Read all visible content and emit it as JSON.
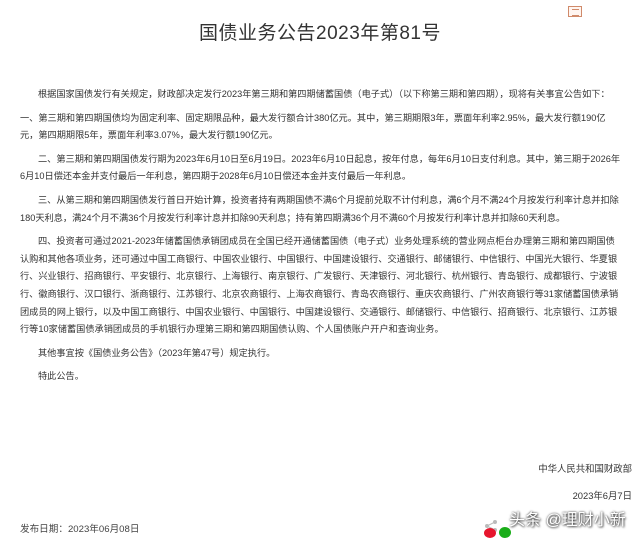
{
  "title": "国债业务公告2023年第81号",
  "paragraphs": [
    "根据国家国债发行有关规定，财政部决定发行2023年第三期和第四期储蓄国债（电子式）（以下称第三期和第四期），现将有关事宜公告如下：",
    "一、第三期和第四期国债均为固定利率、固定期限品种，最大发行额合计380亿元。其中，第三期期限3年，票面年利率2.95%，最大发行额190亿元，第四期期限5年，票面年利率3.07%，最大发行额190亿元。",
    "二、第三期和第四期国债发行期为2023年6月10日至6月19日。2023年6月10日起息，按年付息，每年6月10日支付利息。其中，第三期于2026年6月10日偿还本金并支付最后一年利息，第四期于2028年6月10日偿还本金并支付最后一年利息。",
    "三、从第三期和第四期国债发行首日开始计算，投资者持有两期国债不满6个月提前兑取不计付利息，满6个月不满24个月按发行利率计息并扣除180天利息，满24个月不满36个月按发行利率计息并扣除90天利息；持有第四期满36个月不满60个月按发行利率计息并扣除60天利息。",
    "四、投资者可通过2021-2023年储蓄国债承销团成员在全国已经开通储蓄国债（电子式）业务处理系统的营业网点柜台办理第三期和第四期国债认购和其他各项业务，还可通过中国工商银行、中国农业银行、中国银行、中国建设银行、交通银行、邮储银行、中信银行、中国光大银行、华夏银行、兴业银行、招商银行、平安银行、北京银行、上海银行、南京银行、广发银行、天津银行、河北银行、杭州银行、青岛银行、成都银行、宁波银行、徽商银行、汉口银行、浙商银行、江苏银行、北京农商银行、上海农商银行、青岛农商银行、重庆农商银行、广州农商银行等31家储蓄国债承销团成员的网上银行，以及中国工商银行、中国农业银行、中国银行、中国建设银行、交通银行、邮储银行、中信银行、招商银行、北京银行、江苏银行等10家储蓄国债承销团成员的手机银行办理第三期和第四期国债认购、个人国债账户开户和查询业务。",
    "其他事宜按《国债业务公告》（2023年第47号）规定执行。",
    "特此公告。"
  ],
  "signature": {
    "org": "中华人民共和国财政部",
    "date": "2023年6月7日"
  },
  "release": {
    "label": "发布日期：",
    "date": "2023年06月08日"
  },
  "watermark": "头条 @理财小新",
  "icons": [
    "print-icon",
    "share-icon",
    "weibo-icon",
    "wechat-icon"
  ],
  "colors": {
    "weibo": "#e6162d",
    "wechat": "#1aad19"
  }
}
